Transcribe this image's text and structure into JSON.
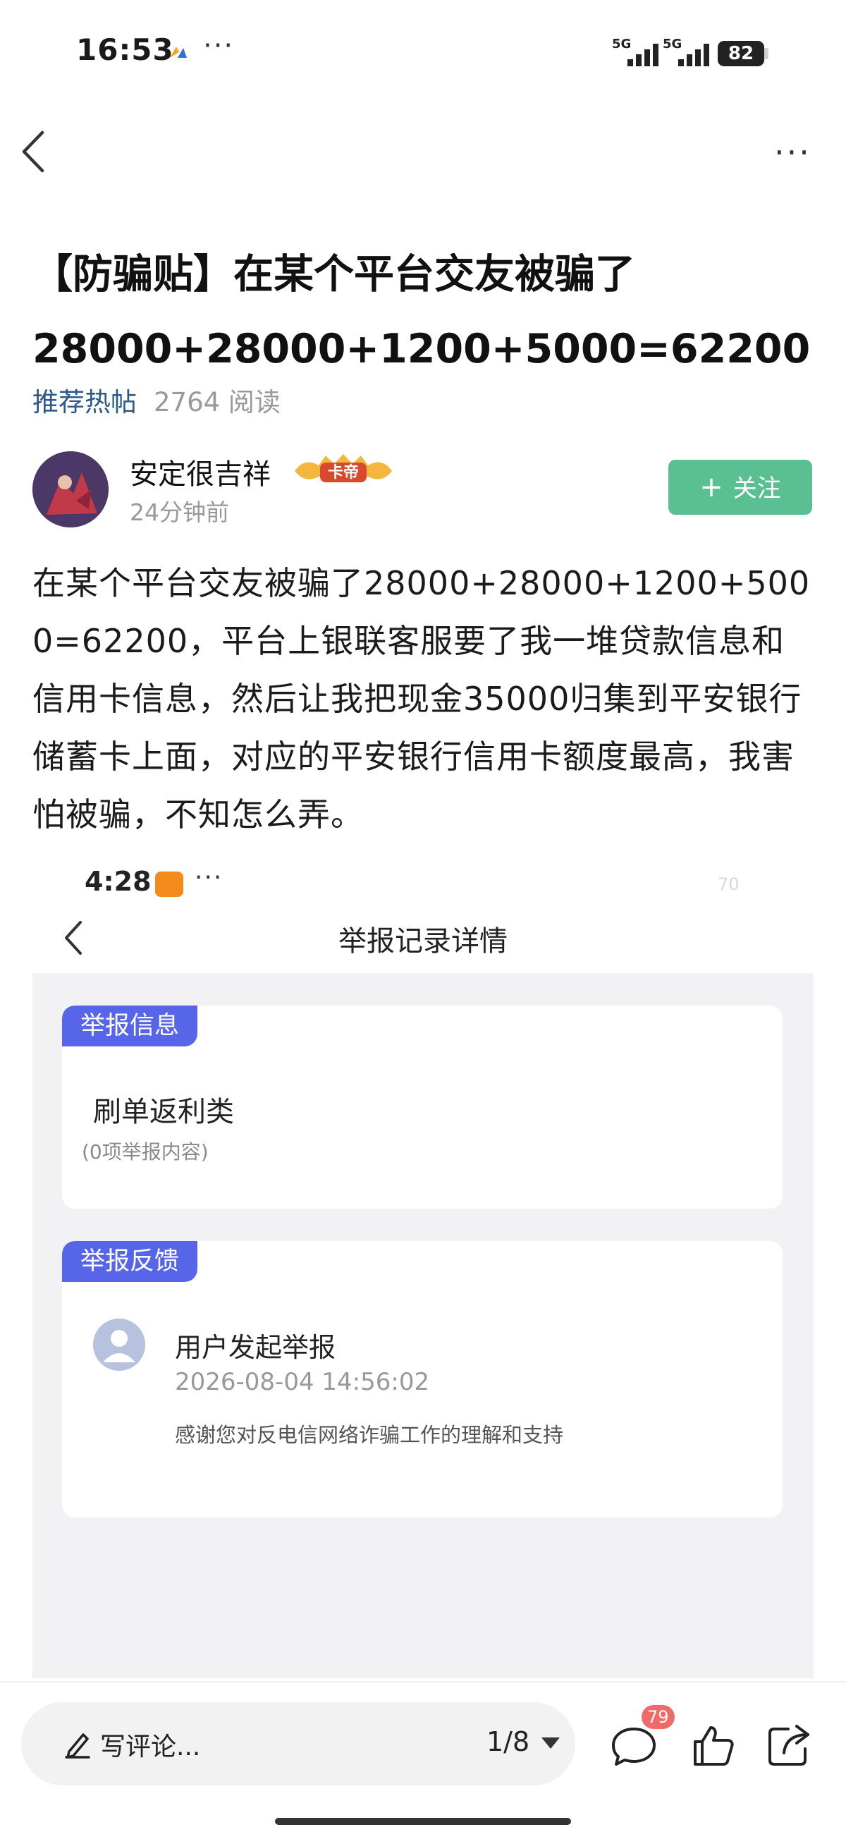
{
  "status_bar": {
    "time": "16:53",
    "more": "···",
    "signal_1": "5G",
    "signal_2": "5G",
    "battery": "82"
  },
  "nav": {
    "more": "···"
  },
  "post": {
    "title_line1": "【防骗贴】在某个平台交友被骗了",
    "title_line2": "28000+28000+1200+5000=62200",
    "tag": "推荐热帖",
    "read_count": "2764 阅读",
    "author": {
      "name": "安定很吉祥",
      "time": "24分钟前",
      "badge": "卡帝"
    },
    "follow_label": "关注",
    "follow_plus": "+",
    "body": "在某个平台交友被骗了28000+28000+1200+5000=62200，平台上银联客服要了我一堆贷款信息和信用卡信息，然后让我把现金35000归集到平安银行储蓄卡上面，对应的平安银行信用卡额度最高，我害怕被骗，不知怎么弄。"
  },
  "embedded_screenshot": {
    "time": "4:28",
    "more": "···",
    "corner": "70",
    "title": "举报记录详情",
    "report_info": {
      "tag": "举报信息",
      "category": "刷单返利类",
      "note": "(0项举报内容)"
    },
    "report_feedback": {
      "tag": "举报反馈",
      "title": "用户发起举报",
      "time": "2026-08-04 14:56:02",
      "message": "感谢您对反电信网络诈骗工作的理解和支持"
    }
  },
  "bottom_bar": {
    "comment_placeholder": "写评论...",
    "page_indicator": "1/8",
    "comment_count": "79"
  },
  "icons": [
    "back-icon",
    "more-icon",
    "plus-icon",
    "pencil-icon",
    "caret-down-icon",
    "comment-icon",
    "like-icon",
    "share-icon",
    "user-icon"
  ],
  "colors": {
    "follow_button": "#5bbf94",
    "tag_blue": "#5766e8",
    "meta_tag": "#2a5a8a",
    "badge_red": "#f06a6a"
  }
}
